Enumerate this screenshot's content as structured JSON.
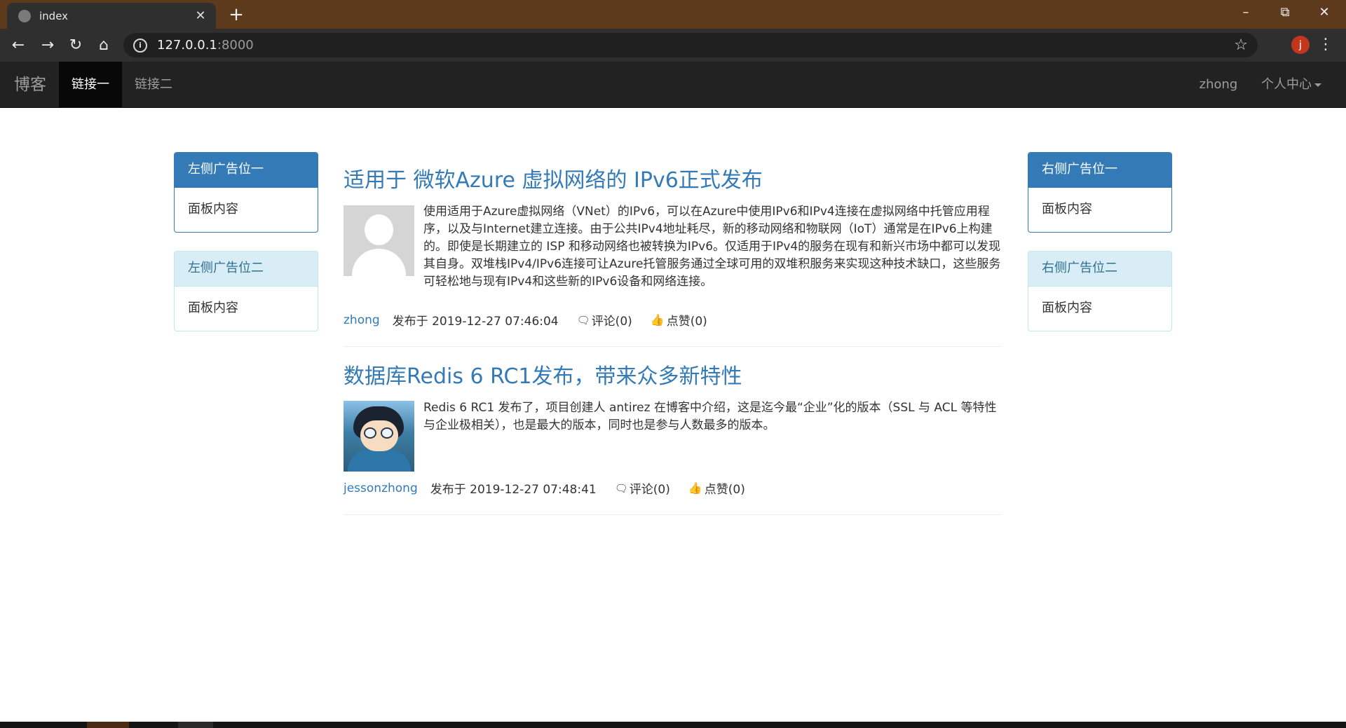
{
  "browser": {
    "tab_title": "index",
    "tab_close": "✕",
    "new_tab": "+",
    "url_host": "127.0.0.1",
    "url_port": ":8000",
    "profile_initial": "j"
  },
  "navbar": {
    "brand": "博客",
    "links": [
      "链接一",
      "链接二"
    ],
    "user": "zhong",
    "personal_center": "个人中心"
  },
  "left_panels": [
    {
      "heading": "左侧广告位一",
      "body": "面板内容",
      "style": "primary"
    },
    {
      "heading": "左侧广告位二",
      "body": "面板内容",
      "style": "info"
    }
  ],
  "right_panels": [
    {
      "heading": "右侧广告位一",
      "body": "面板内容",
      "style": "primary"
    },
    {
      "heading": "右侧广告位二",
      "body": "面板内容",
      "style": "info"
    }
  ],
  "articles": [
    {
      "title": "适用于 微软Azure 虚拟网络的 IPv6正式发布",
      "summary": "使用适用于Azure虚拟网络（VNet）的IPv6，可以在Azure中使用IPv6和IPv4连接在虚拟网络中托管应用程序，以及与Internet建立连接。由于公共IPv4地址耗尽，新的移动网络和物联网（IoT）通常是在IPv6上构建的。即使是长期建立的 ISP 和移动网络也被转换为IPv6。仅适用于IPv4的服务在现有和新兴市场中都可以发现其自身。双堆栈IPv4/IPv6连接可让Azure托管服务通过全球可用的双堆积服务来实现这种技术缺口，这些服务可轻松地与现有IPv4和这些新的IPv6设备和网络连接。",
      "author": "zhong",
      "published": "发布于 2019-12-27 07:46:04",
      "comments": "评论(0)",
      "likes": "点赞(0)"
    },
    {
      "title": "数据库Redis 6 RC1发布，带来众多新特性",
      "summary": "Redis 6 RC1 发布了，项目创建人 antirez 在博客中介绍，这是迄今最“企业”化的版本（SSL 与 ACL 等特性与企业极相关），也是最大的版本，同时也是参与人数最多的版本。",
      "author": "jessonzhong",
      "published": "发布于 2019-12-27 07:48:41",
      "comments": "评论(0)",
      "likes": "点赞(0)"
    }
  ],
  "icons": {
    "comment": "comment-icon",
    "like": "thumbs-up-icon"
  },
  "colors": {
    "link": "#337ab7",
    "navbar_bg": "#222222",
    "titlebar_bg": "#5e3a1d"
  }
}
